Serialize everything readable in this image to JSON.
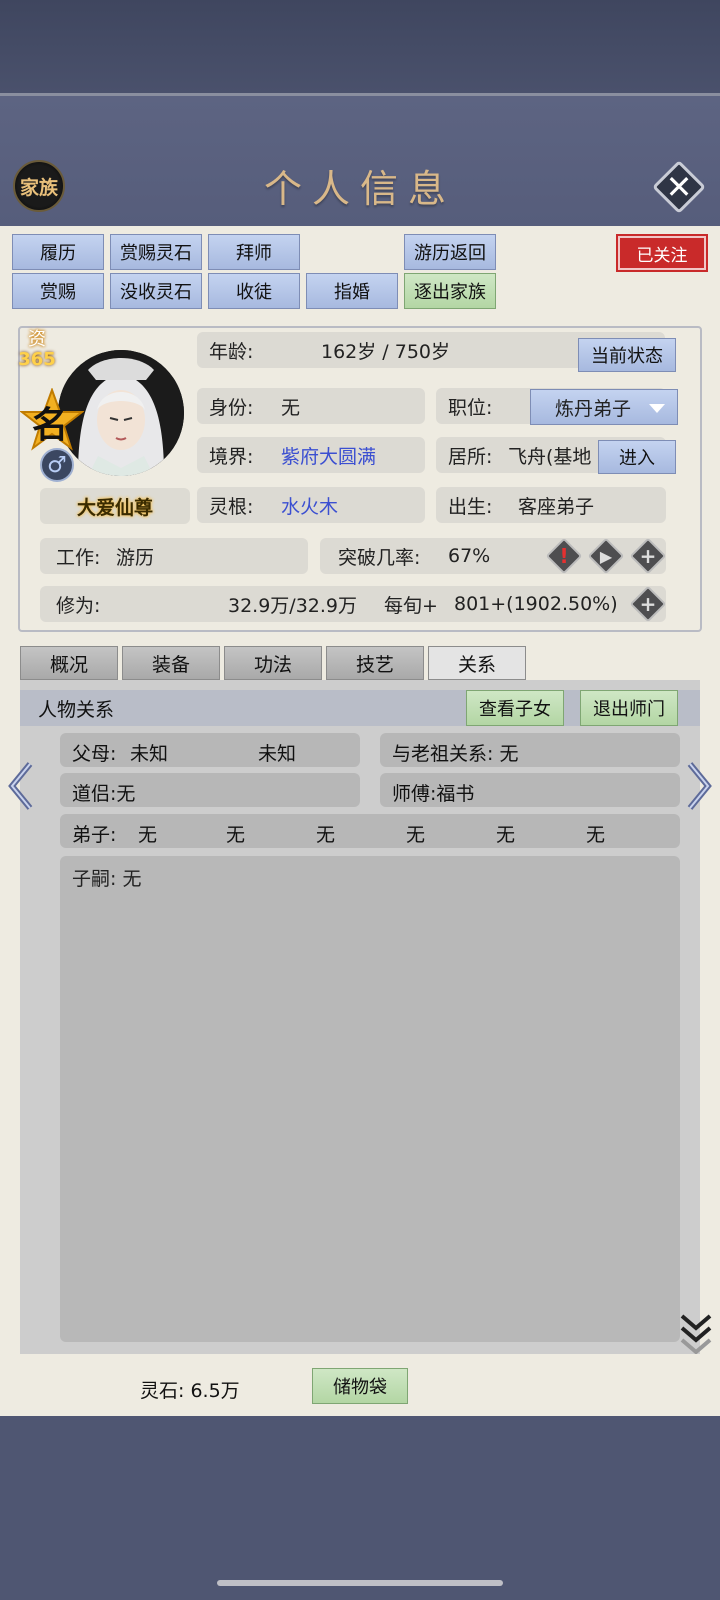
{
  "header": {
    "family_label": "家族",
    "title": "个人信息"
  },
  "actions": {
    "row1": [
      "履历",
      "赏赐灵石",
      "拜师",
      "游历返回"
    ],
    "row2": [
      "赏赐",
      "没收灵石",
      "收徒",
      "指婚",
      "逐出家族"
    ],
    "followed": "已关注"
  },
  "profile": {
    "zi_label": "资",
    "zi_value": "365",
    "ming_label": "名",
    "gender_symbol": "♂",
    "name": "大爱仙尊",
    "age_label": "年龄:",
    "age_value": "162岁 / 750岁",
    "status_button": "当前状态",
    "identity_label": "身份:",
    "identity_value": "无",
    "position_label": "职位:",
    "position_value": "炼丹弟子",
    "realm_label": "境界:",
    "realm_value": "紫府大圆满",
    "residence_label": "居所:",
    "residence_value": "飞舟(基地",
    "enter_button": "进入",
    "root_label": "灵根:",
    "root_value": "水火木",
    "birth_label": "出生:",
    "birth_value": "客座弟子",
    "job_label": "工作:",
    "job_value": "游历",
    "breakthrough_label": "突破几率:",
    "breakthrough_value": "67%",
    "cultivation_label": "修为:",
    "cultivation_value": "32.9万/32.9万",
    "per_turn_label": "每旬+",
    "per_turn_value": "801+(1902.50%)"
  },
  "tabs": [
    "概况",
    "装备",
    "功法",
    "技艺",
    "关系"
  ],
  "relations": {
    "title": "人物关系",
    "view_children": "查看子女",
    "leave_master": "退出师门",
    "parents_label": "父母:",
    "parents": [
      "未知",
      "未知"
    ],
    "ancestor_relation": "与老祖关系: 无",
    "partner": "道侣:无",
    "master": "师傅:福书",
    "disciples_label": "弟子:",
    "disciples": [
      "无",
      "无",
      "无",
      "无",
      "无",
      "无"
    ],
    "heirs": "子嗣: 无"
  },
  "footer": {
    "spirit_stone": "灵石: 6.5万",
    "bag_button": "储物袋"
  },
  "colors": {
    "accent_blue": "#3b4fd1",
    "follow_red": "#c92a2a",
    "title_gold": "#d9b889"
  }
}
